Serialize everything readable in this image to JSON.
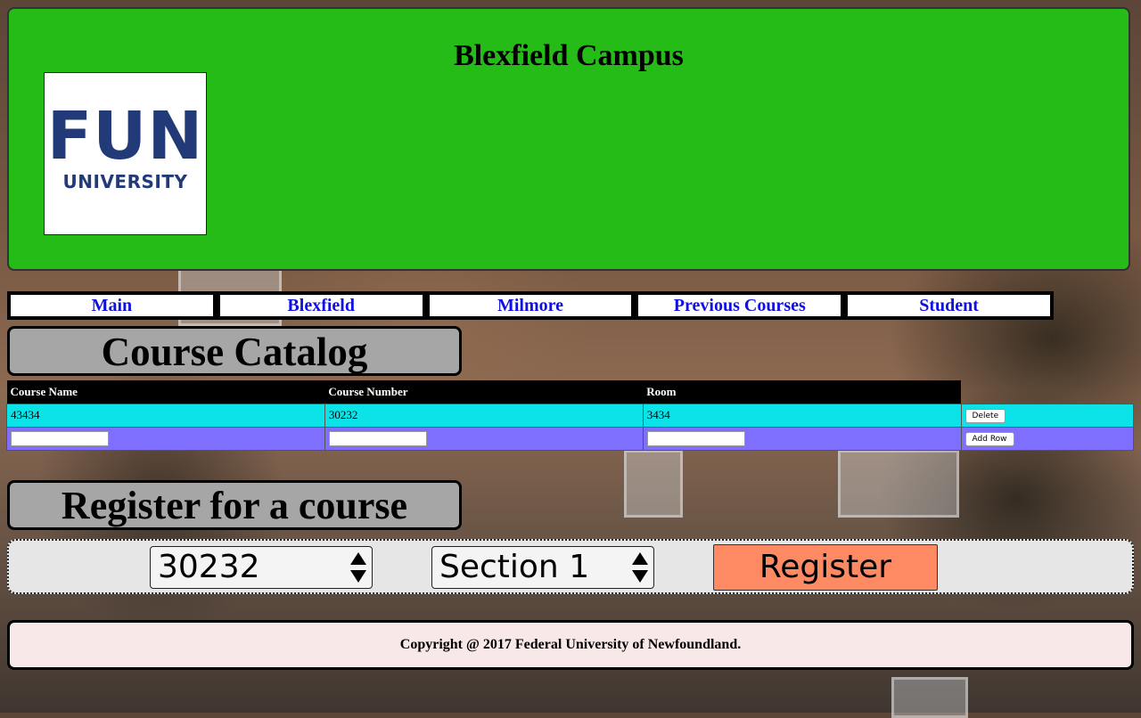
{
  "header": {
    "title": "Blexfield Campus",
    "logo_text_main": "FUN",
    "logo_text_sub": "UNIVERSITY"
  },
  "nav": {
    "items": [
      {
        "label": "Main"
      },
      {
        "label": "Blexfield"
      },
      {
        "label": "Milmore"
      },
      {
        "label": "Previous Courses"
      },
      {
        "label": "Student"
      }
    ]
  },
  "catalog": {
    "heading": "Course Catalog",
    "columns": [
      "Course Name",
      "Course Number",
      "Room"
    ],
    "rows": [
      {
        "course_name": "43434",
        "course_number": "30232",
        "room": "3434",
        "action_label": "Delete"
      }
    ],
    "new_row": {
      "course_name": "",
      "course_number": "",
      "room": "",
      "action_label": "Add Row"
    }
  },
  "register": {
    "heading": "Register for a course",
    "course_select_value": "30232",
    "section_select_value": "Section 1",
    "button_label": "Register"
  },
  "footer": {
    "text": "Copyright @ 2017 Federal University of Newfoundland."
  },
  "colors": {
    "header_bg": "#26bc17",
    "nav_link": "#1010e0",
    "row_data_bg": "#0be3e8",
    "row_new_bg": "#7e6fff",
    "register_button_bg": "#fe8a64",
    "footer_bg": "#f8e8e8"
  }
}
